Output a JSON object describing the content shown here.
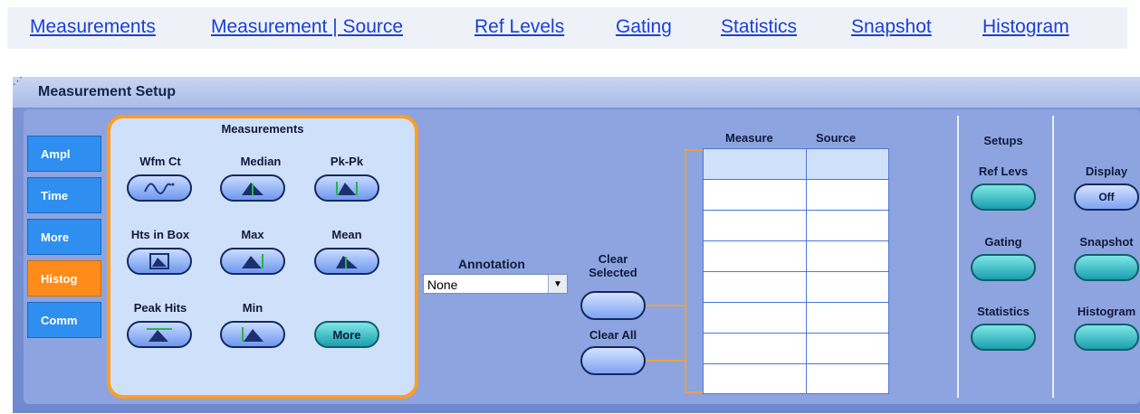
{
  "top_links": [
    "Measurements",
    "Measurement | Source",
    "Ref Levels",
    "Gating",
    "Statistics",
    "Snapshot",
    "Histogram"
  ],
  "window": {
    "title": "Measurement Setup"
  },
  "tabs": [
    {
      "label": "Ampl",
      "active": false
    },
    {
      "label": "Time",
      "active": false
    },
    {
      "label": "More",
      "active": false
    },
    {
      "label": "Histog",
      "active": true
    },
    {
      "label": "Comm",
      "active": false
    }
  ],
  "measurements": {
    "title": "Measurements",
    "items": [
      {
        "label": "Wfm Ct",
        "icon": "waveform-count-icon"
      },
      {
        "label": "Median",
        "icon": "median-histogram-icon"
      },
      {
        "label": "Pk-Pk",
        "icon": "pk-pk-histogram-icon"
      },
      {
        "label": "Hts in Box",
        "icon": "hits-in-box-icon"
      },
      {
        "label": "Max",
        "icon": "max-histogram-icon"
      },
      {
        "label": "Mean",
        "icon": "mean-histogram-icon"
      },
      {
        "label": "Peak Hits",
        "icon": "peak-hits-icon"
      },
      {
        "label": "Min",
        "icon": "min-histogram-icon"
      }
    ],
    "more_label": "More"
  },
  "annotation": {
    "label": "Annotation",
    "value": "None"
  },
  "clear": {
    "selected_line1": "Clear",
    "selected_line2": "Selected",
    "all": "Clear All"
  },
  "table": {
    "col_measure": "Measure",
    "col_source": "Source",
    "rows": 8
  },
  "setups": {
    "title": "Setups",
    "ref_levs": "Ref Levs",
    "gating": "Gating",
    "statistics": "Statistics"
  },
  "display": {
    "label": "Display",
    "value": "Off",
    "snapshot": "Snapshot",
    "histogram": "Histogram"
  },
  "colors": {
    "accent_orange": "#ff9e1f",
    "tab_blue": "#2e8ff0",
    "panel_blue": "#8da4e0",
    "link_blue": "#1a3fd6"
  }
}
